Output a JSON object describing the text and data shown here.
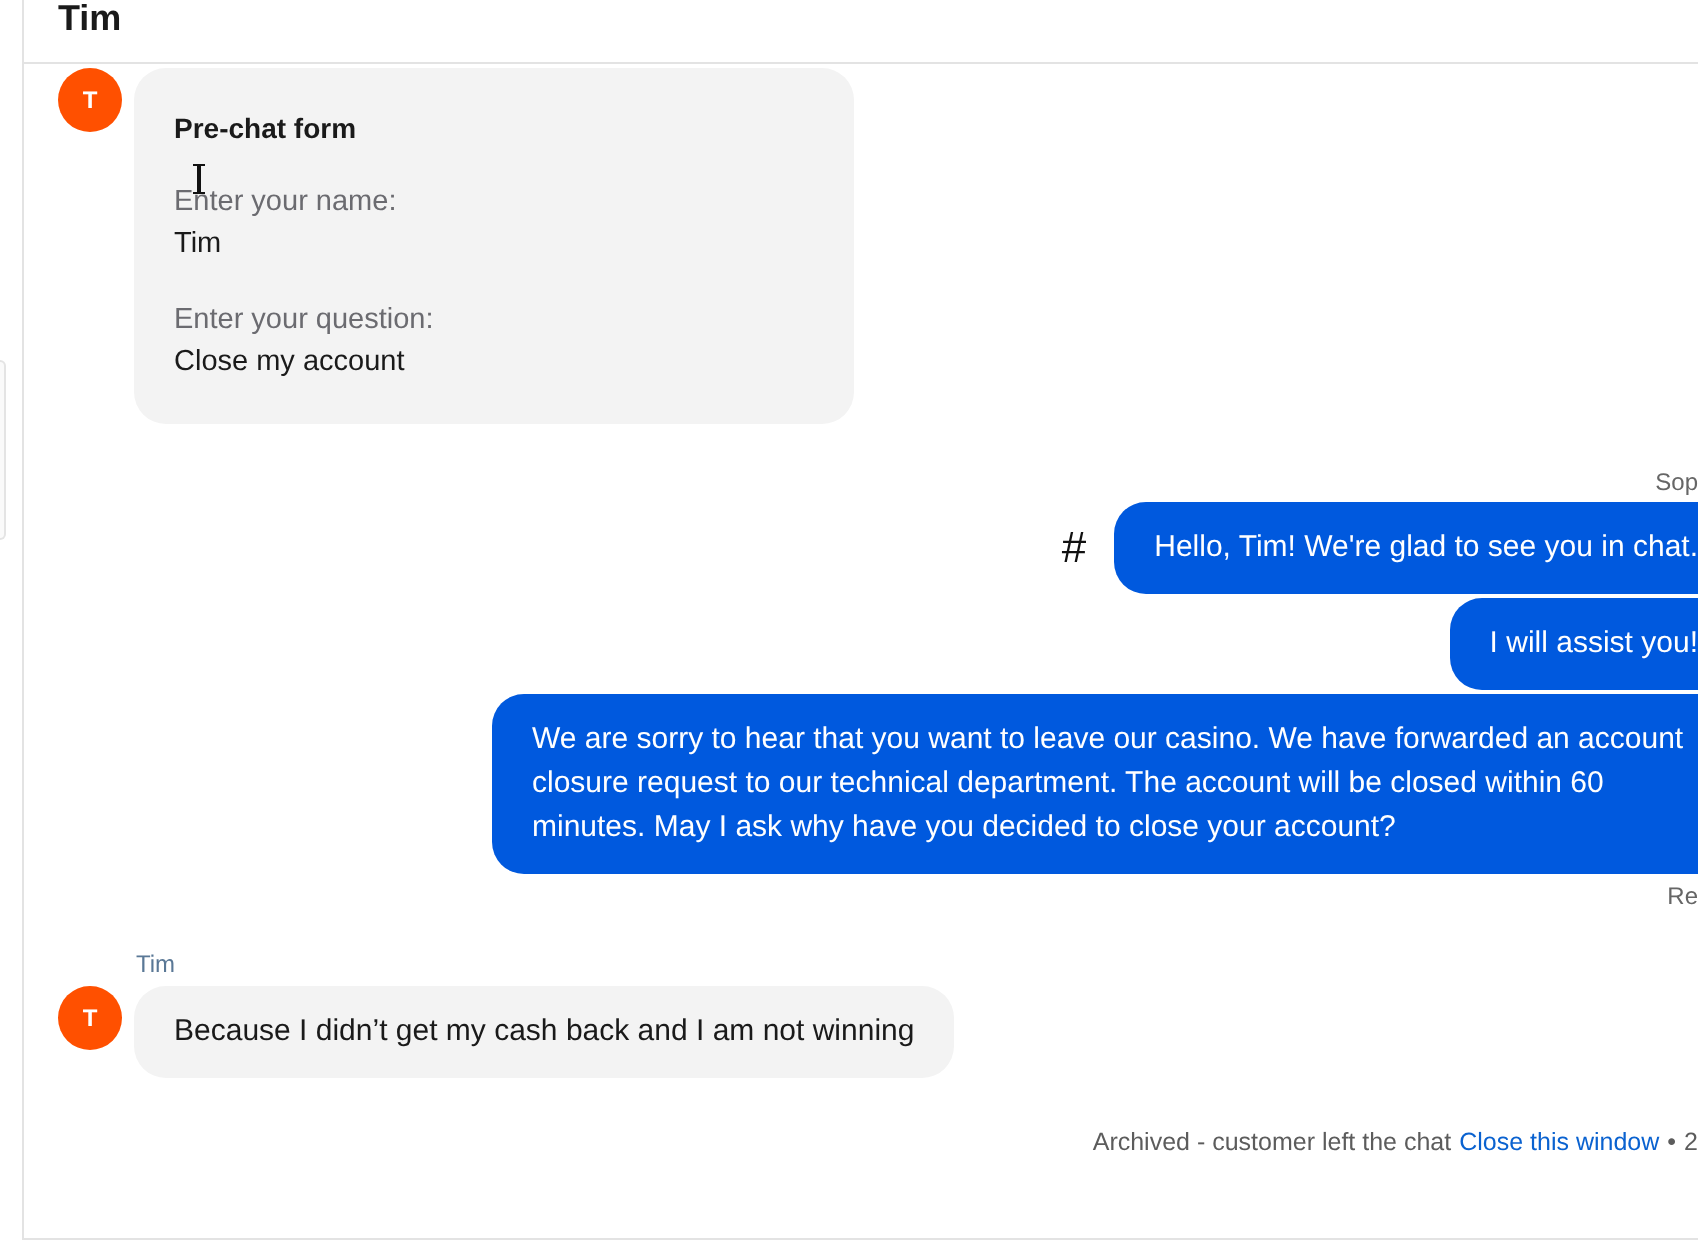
{
  "header": {
    "title": "Tim"
  },
  "messages": [
    {
      "kind": "form",
      "avatar": "T",
      "title": "Pre-chat form",
      "fields": [
        {
          "label": "Enter your name:",
          "value": "Tim"
        },
        {
          "label": "Enter your question:",
          "value": "Close my account"
        }
      ]
    },
    {
      "kind": "agent",
      "author": "Sop",
      "marker": "#",
      "bubbles": [
        "Hello, Tim! We're glad to see you in chat.",
        "I will assist you!",
        "We are sorry to hear that you want to leave our casino. We have forwarded an account closure request to our technical department. The account will be closed within 60 minutes. May I ask why have you decided to close your account?"
      ],
      "status": "Re"
    },
    {
      "kind": "customer",
      "author": "Tim",
      "avatar": "T",
      "text": "Because I didn’t get my cash back and I am not winning"
    }
  ],
  "footer": {
    "status": "Archived - customer left the chat",
    "link": "Close this window",
    "separator": "•",
    "time": "2"
  }
}
